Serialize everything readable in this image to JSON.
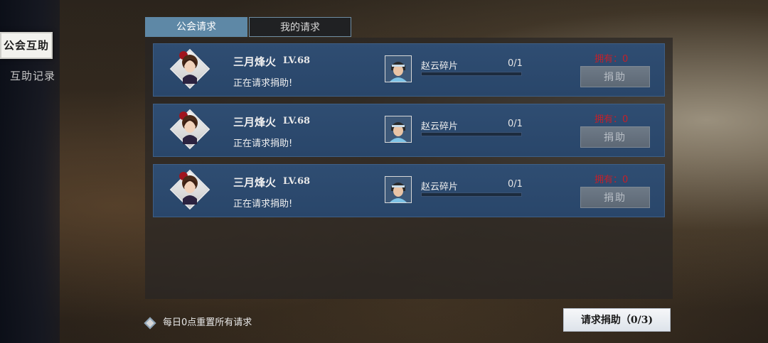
{
  "sidebar": {
    "tabs": [
      {
        "label": "公会互助",
        "active": true
      },
      {
        "label": "互助记录",
        "active": false
      }
    ]
  },
  "tabs": [
    {
      "label": "公会请求",
      "active": true
    },
    {
      "label": "我的请求",
      "active": false
    }
  ],
  "requests": [
    {
      "name": "三月烽火",
      "level": "LV.68",
      "status": "正在请求捐助!",
      "item": "赵云碎片",
      "count": "0/1",
      "progress": 0,
      "owned": "拥有：0",
      "button": "捐助"
    },
    {
      "name": "三月烽火",
      "level": "LV.68",
      "status": "正在请求捐助!",
      "item": "赵云碎片",
      "count": "0/1",
      "progress": 0,
      "owned": "拥有：0",
      "button": "捐助"
    },
    {
      "name": "三月烽火",
      "level": "LV.68",
      "status": "正在请求捐助!",
      "item": "赵云碎片",
      "count": "0/1",
      "progress": 0,
      "owned": "拥有：0",
      "button": "捐助"
    }
  ],
  "footer": {
    "note": "每日0点重置所有请求",
    "request_button": "请求捐助（0/3)"
  },
  "colors": {
    "accent_tab": "#5e88a6",
    "row_bg": "#2f4d72",
    "owned_text": "#c4202a"
  },
  "icons": {
    "avatar": "player-portrait-icon",
    "item": "zhao-yun-shard-icon",
    "note": "diamond-bullet-icon"
  }
}
